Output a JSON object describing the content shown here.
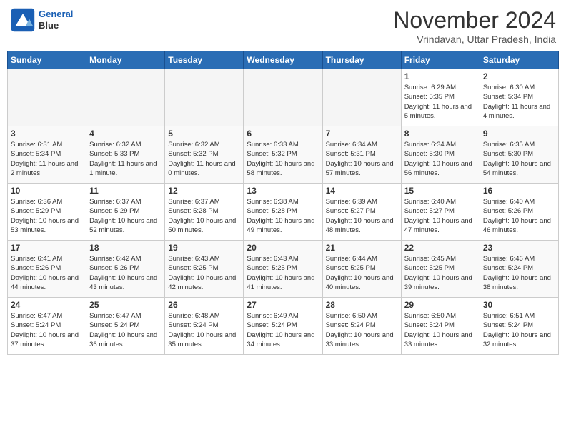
{
  "header": {
    "logo_line1": "General",
    "logo_line2": "Blue",
    "month": "November 2024",
    "location": "Vrindavan, Uttar Pradesh, India"
  },
  "weekdays": [
    "Sunday",
    "Monday",
    "Tuesday",
    "Wednesday",
    "Thursday",
    "Friday",
    "Saturday"
  ],
  "weeks": [
    [
      {
        "day": "",
        "info": ""
      },
      {
        "day": "",
        "info": ""
      },
      {
        "day": "",
        "info": ""
      },
      {
        "day": "",
        "info": ""
      },
      {
        "day": "",
        "info": ""
      },
      {
        "day": "1",
        "info": "Sunrise: 6:29 AM\nSunset: 5:35 PM\nDaylight: 11 hours and 5 minutes."
      },
      {
        "day": "2",
        "info": "Sunrise: 6:30 AM\nSunset: 5:34 PM\nDaylight: 11 hours and 4 minutes."
      }
    ],
    [
      {
        "day": "3",
        "info": "Sunrise: 6:31 AM\nSunset: 5:34 PM\nDaylight: 11 hours and 2 minutes."
      },
      {
        "day": "4",
        "info": "Sunrise: 6:32 AM\nSunset: 5:33 PM\nDaylight: 11 hours and 1 minute."
      },
      {
        "day": "5",
        "info": "Sunrise: 6:32 AM\nSunset: 5:32 PM\nDaylight: 11 hours and 0 minutes."
      },
      {
        "day": "6",
        "info": "Sunrise: 6:33 AM\nSunset: 5:32 PM\nDaylight: 10 hours and 58 minutes."
      },
      {
        "day": "7",
        "info": "Sunrise: 6:34 AM\nSunset: 5:31 PM\nDaylight: 10 hours and 57 minutes."
      },
      {
        "day": "8",
        "info": "Sunrise: 6:34 AM\nSunset: 5:30 PM\nDaylight: 10 hours and 56 minutes."
      },
      {
        "day": "9",
        "info": "Sunrise: 6:35 AM\nSunset: 5:30 PM\nDaylight: 10 hours and 54 minutes."
      }
    ],
    [
      {
        "day": "10",
        "info": "Sunrise: 6:36 AM\nSunset: 5:29 PM\nDaylight: 10 hours and 53 minutes."
      },
      {
        "day": "11",
        "info": "Sunrise: 6:37 AM\nSunset: 5:29 PM\nDaylight: 10 hours and 52 minutes."
      },
      {
        "day": "12",
        "info": "Sunrise: 6:37 AM\nSunset: 5:28 PM\nDaylight: 10 hours and 50 minutes."
      },
      {
        "day": "13",
        "info": "Sunrise: 6:38 AM\nSunset: 5:28 PM\nDaylight: 10 hours and 49 minutes."
      },
      {
        "day": "14",
        "info": "Sunrise: 6:39 AM\nSunset: 5:27 PM\nDaylight: 10 hours and 48 minutes."
      },
      {
        "day": "15",
        "info": "Sunrise: 6:40 AM\nSunset: 5:27 PM\nDaylight: 10 hours and 47 minutes."
      },
      {
        "day": "16",
        "info": "Sunrise: 6:40 AM\nSunset: 5:26 PM\nDaylight: 10 hours and 46 minutes."
      }
    ],
    [
      {
        "day": "17",
        "info": "Sunrise: 6:41 AM\nSunset: 5:26 PM\nDaylight: 10 hours and 44 minutes."
      },
      {
        "day": "18",
        "info": "Sunrise: 6:42 AM\nSunset: 5:26 PM\nDaylight: 10 hours and 43 minutes."
      },
      {
        "day": "19",
        "info": "Sunrise: 6:43 AM\nSunset: 5:25 PM\nDaylight: 10 hours and 42 minutes."
      },
      {
        "day": "20",
        "info": "Sunrise: 6:43 AM\nSunset: 5:25 PM\nDaylight: 10 hours and 41 minutes."
      },
      {
        "day": "21",
        "info": "Sunrise: 6:44 AM\nSunset: 5:25 PM\nDaylight: 10 hours and 40 minutes."
      },
      {
        "day": "22",
        "info": "Sunrise: 6:45 AM\nSunset: 5:25 PM\nDaylight: 10 hours and 39 minutes."
      },
      {
        "day": "23",
        "info": "Sunrise: 6:46 AM\nSunset: 5:24 PM\nDaylight: 10 hours and 38 minutes."
      }
    ],
    [
      {
        "day": "24",
        "info": "Sunrise: 6:47 AM\nSunset: 5:24 PM\nDaylight: 10 hours and 37 minutes."
      },
      {
        "day": "25",
        "info": "Sunrise: 6:47 AM\nSunset: 5:24 PM\nDaylight: 10 hours and 36 minutes."
      },
      {
        "day": "26",
        "info": "Sunrise: 6:48 AM\nSunset: 5:24 PM\nDaylight: 10 hours and 35 minutes."
      },
      {
        "day": "27",
        "info": "Sunrise: 6:49 AM\nSunset: 5:24 PM\nDaylight: 10 hours and 34 minutes."
      },
      {
        "day": "28",
        "info": "Sunrise: 6:50 AM\nSunset: 5:24 PM\nDaylight: 10 hours and 33 minutes."
      },
      {
        "day": "29",
        "info": "Sunrise: 6:50 AM\nSunset: 5:24 PM\nDaylight: 10 hours and 33 minutes."
      },
      {
        "day": "30",
        "info": "Sunrise: 6:51 AM\nSunset: 5:24 PM\nDaylight: 10 hours and 32 minutes."
      }
    ]
  ]
}
